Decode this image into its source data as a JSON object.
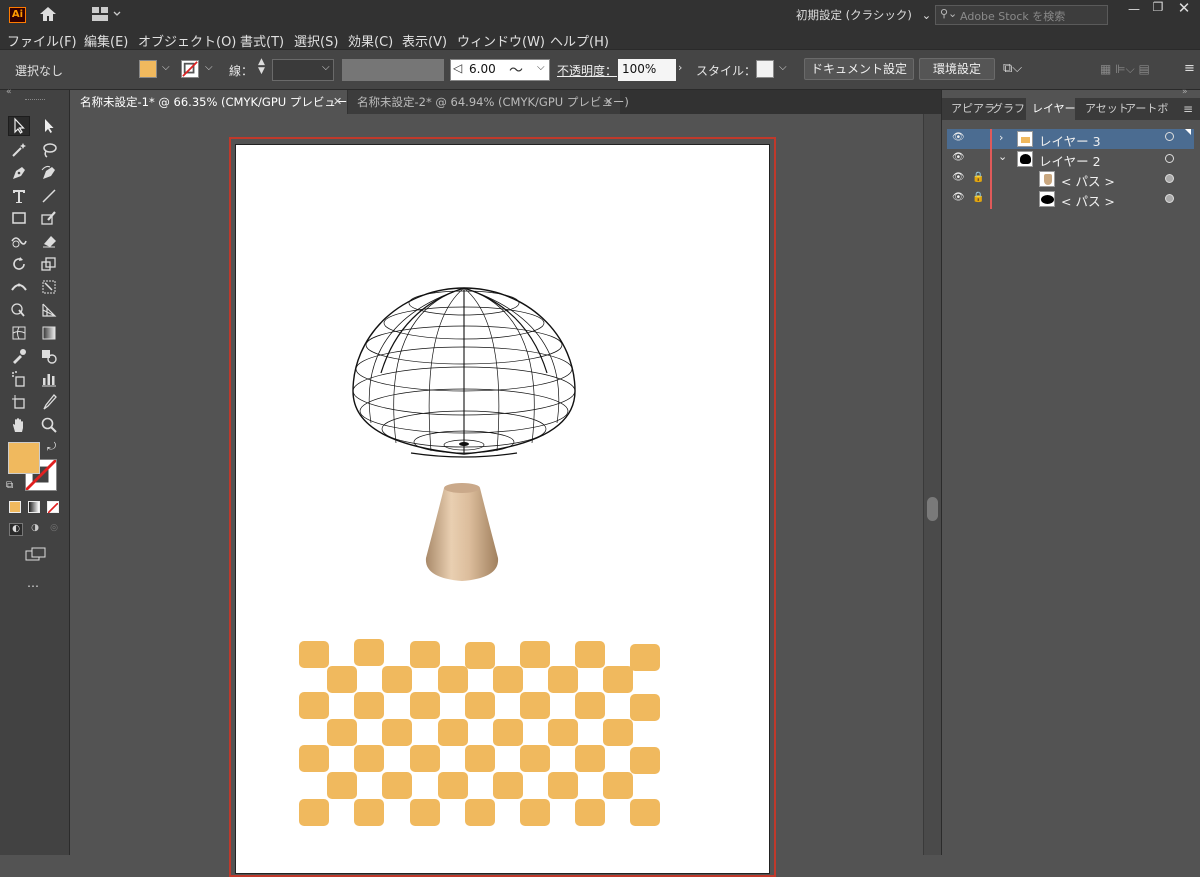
{
  "app": {
    "logo": "Ai",
    "workspace": "初期設定 (クラシック)",
    "search_placeholder": "Adobe Stock を検索"
  },
  "menu": [
    "ファイル(F)",
    "編集(E)",
    "オブジェクト(O)",
    "書式(T)",
    "選択(S)",
    "効果(C)",
    "表示(V)",
    "ウィンドウ(W)",
    "ヘルプ(H)"
  ],
  "control": {
    "selection": "選択なし",
    "stroke_label": "線：",
    "stroke_weight": "6.00",
    "opacity_label": "不透明度：",
    "opacity_value": "100%",
    "style_label": "スタイル：",
    "doc_settings": "ドキュメント設定",
    "prefs": "環境設定"
  },
  "colors": {
    "fill": "#f0b95e",
    "accent_red": "#c0392b",
    "layer_color": "#e05a5a"
  },
  "tabs": [
    {
      "label": "名称未設定-1* @ 66.35% (CMYK/GPU プレビュー)",
      "active": true
    },
    {
      "label": "名称未設定-2* @ 64.94% (CMYK/GPU プレビュー)",
      "active": false
    }
  ],
  "panel": {
    "tabs": [
      "アピアラ",
      "グラフィ",
      "レイヤー",
      "アセット",
      "アートボ"
    ],
    "active_tab": "レイヤー"
  },
  "layers": [
    {
      "name": "レイヤー 3",
      "expanded": false,
      "locked": false,
      "selected": true
    },
    {
      "name": "レイヤー 2",
      "expanded": true,
      "locked": false,
      "selected": false
    },
    {
      "name": "< パス >",
      "expanded": false,
      "locked": true,
      "selected": false
    },
    {
      "name": "< パス >",
      "expanded": false,
      "locked": true,
      "selected": false
    }
  ],
  "more_tools": "…"
}
